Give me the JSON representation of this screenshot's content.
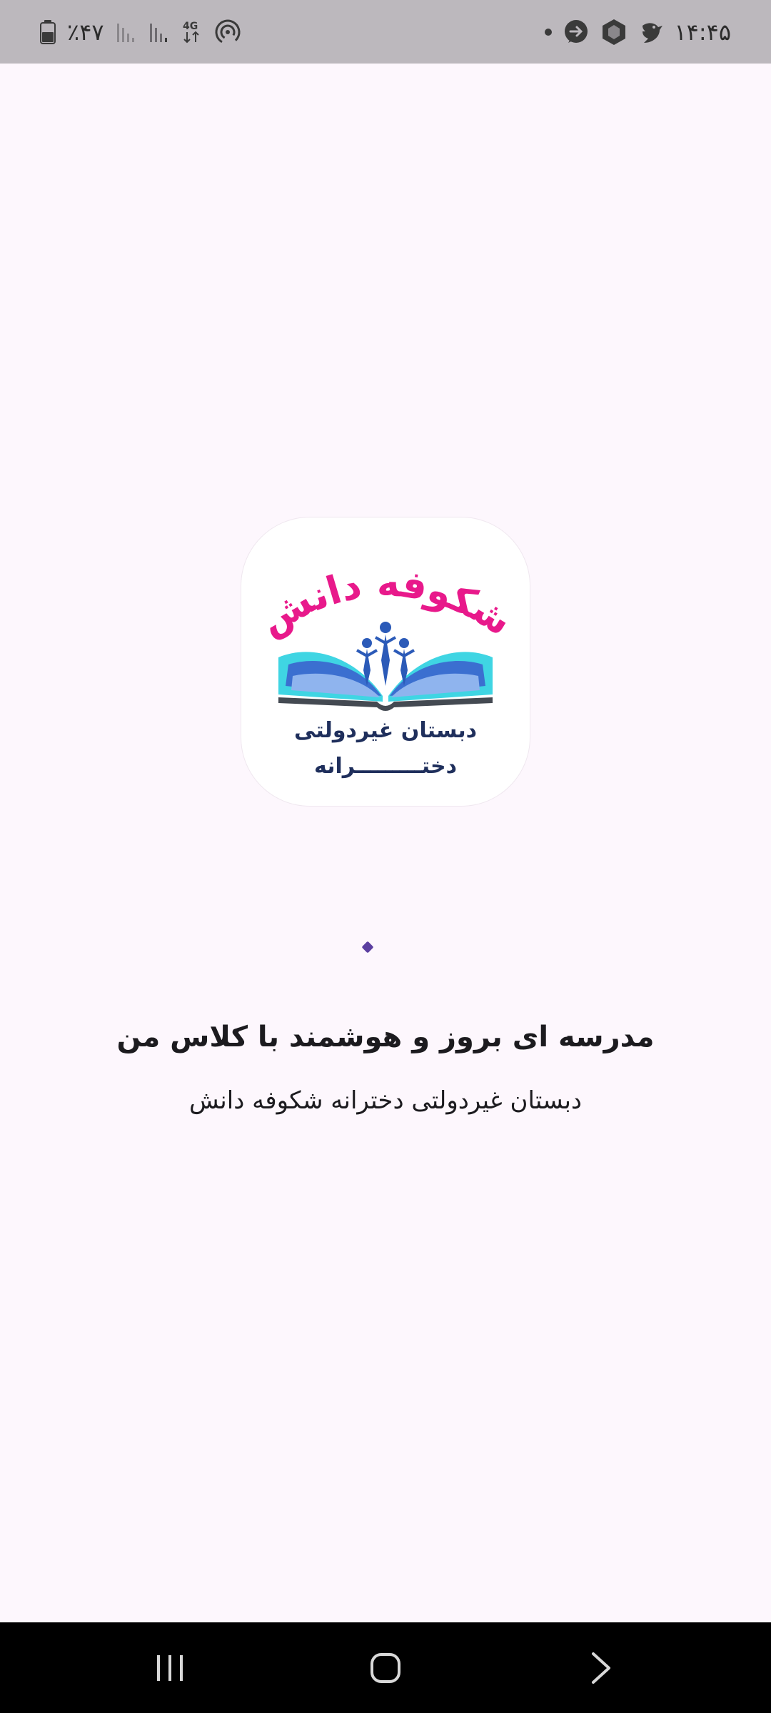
{
  "status_bar": {
    "time": "۱۴:۴۵",
    "battery": "٪۴۷",
    "network": "4G"
  },
  "logo": {
    "brand_name": "شکوفه دانش",
    "line1": "دبستان غیردولتی",
    "line2": "دختـــــــــرانه",
    "colors": {
      "brand_pink": "#e8198b",
      "book_cyan": "#3fd5e3",
      "book_blue": "#3b6fd0",
      "text_navy": "#1f2f5c"
    }
  },
  "splash": {
    "tagline": "مدرسه ای بروز و هوشمند با کلاس من",
    "subtitle": "دبستان غیردولتی دخترانه شکوفه دانش"
  },
  "nav": {
    "recents": "recents-icon",
    "home": "home-icon",
    "back": "back-icon"
  }
}
